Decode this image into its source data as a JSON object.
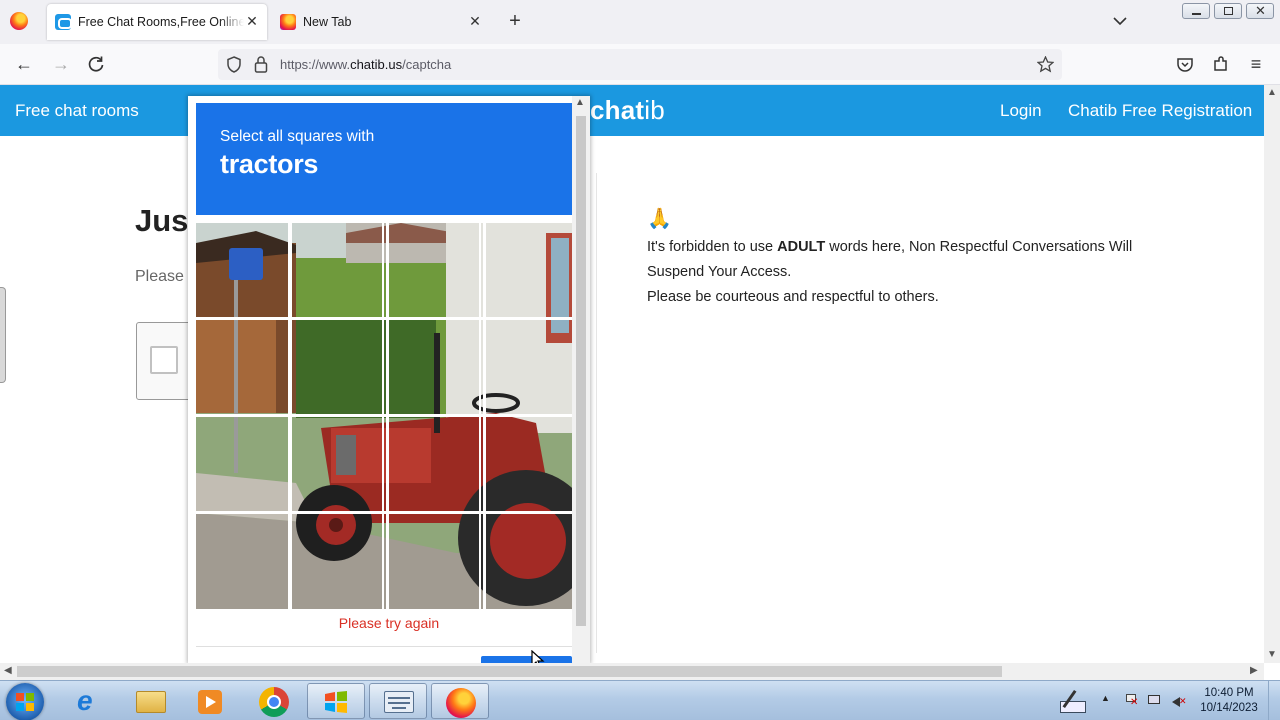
{
  "browser": {
    "tabs": [
      {
        "title": "Free Chat Rooms,Free Online Chat",
        "active": true
      },
      {
        "title": "New Tab",
        "active": false
      }
    ],
    "url_prefix": "https://www.",
    "url_domain": "chatib.us",
    "url_path": "/captcha"
  },
  "site": {
    "nav_left": "Free chat rooms",
    "brand_bold": "chat",
    "brand_light": "ib",
    "nav_login": "Login",
    "nav_register": "Chatib Free Registration",
    "heading": "Just",
    "subheading": "Please",
    "rules": {
      "emoji": "🙏",
      "line1_pre": "It's forbidden to use ",
      "line1_bold": "ADULT",
      "line1_post": " words here, Non Respectful Conversations Will Suspend Your Access.",
      "line2": "Please be courteous and respectful to others."
    }
  },
  "captcha": {
    "prompt": "Select all squares with",
    "target": "tractors",
    "error": "Please try again",
    "grid": {
      "rows": 4,
      "cols": 4
    }
  },
  "taskbar": {
    "time": "10:40 PM",
    "date": "10/14/2023"
  },
  "colors": {
    "site_header": "#1b98e0",
    "captcha_blue": "#1a73e8",
    "error_red": "#d93025"
  }
}
